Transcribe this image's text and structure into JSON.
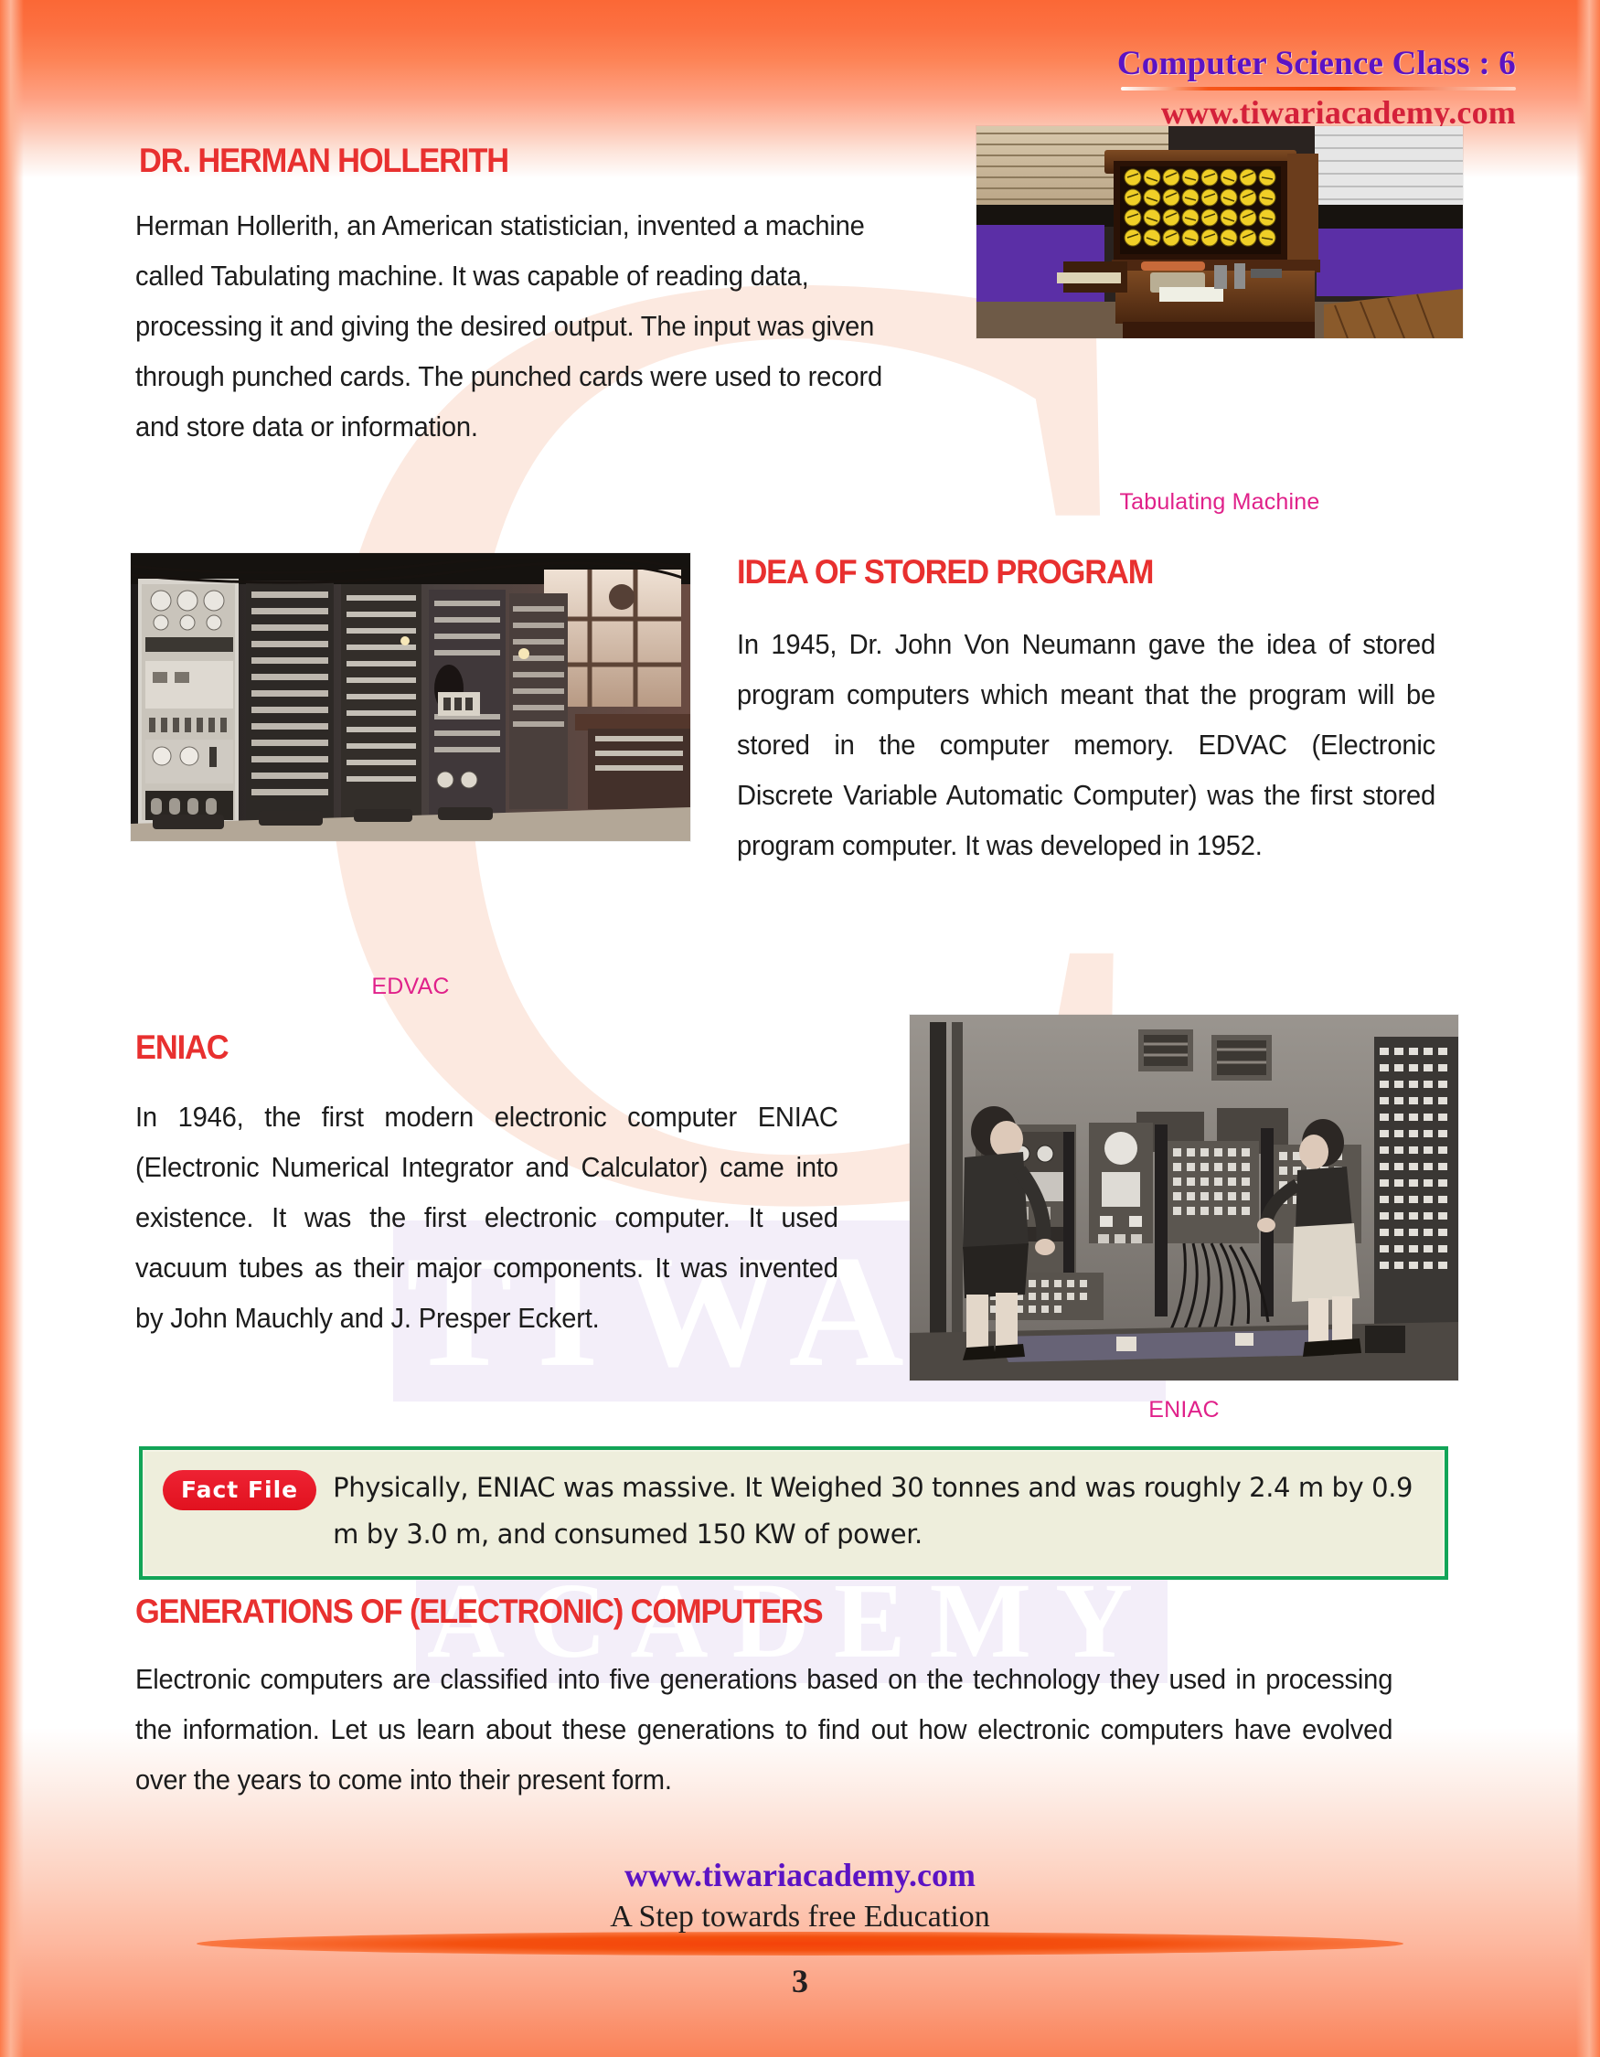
{
  "header": {
    "title": "Computer Science Class : 6",
    "website": "www.tiwariacademy.com"
  },
  "watermark": {
    "letter": "C",
    "word_top": "TIWARI",
    "word_bottom": "ACADEMY"
  },
  "sections": {
    "hollerith": {
      "heading": "DR. HERMAN HOLLERITH",
      "body": "Herman Hollerith, an American statistician, invented a machine called Tabulating machine. It was capable of reading data, processing it and giving the desired output. The input was given through punched cards. The punched cards were used to record and store data or information."
    },
    "stored_program": {
      "heading": "IDEA OF STORED PROGRAM",
      "body": "In 1945, Dr. John Von Neumann gave the idea of stored program computers which meant that the program will be stored in the computer memory. EDVAC (Electronic Discrete Variable Automatic Computer) was the first stored program computer. It was developed in 1952."
    },
    "eniac": {
      "heading": "ENIAC",
      "body": "In 1946, the first modern electronic computer ENIAC (Electronic Numerical Integrator and Calculator) came into existence. It was the first electronic computer. It used vacuum tubes as their major components. It was invented by John Mauchly and J. Presper Eckert."
    },
    "generations": {
      "heading": "GENERATIONS OF (ELECTRONIC) COMPUTERS",
      "body": "Electronic computers are classified into five generations based on the technology they used in processing the information. Let us learn about these generations to find out how electronic computers have evolved over the years to come into their present form."
    }
  },
  "figures": {
    "tabulating_machine": {
      "caption": "Tabulating Machine"
    },
    "edvac": {
      "caption": "EDVAC"
    },
    "eniac": {
      "caption": "ENIAC"
    }
  },
  "fact_file": {
    "badge": "Fact File",
    "text": "Physically, ENIAC was massive. It Weighed 30 tonnes and was roughly 2.4 m by 0.9 m by 3.0 m, and consumed 150 KW of power."
  },
  "footer": {
    "website": "www.tiwariacademy.com",
    "tagline": "A Step towards free Education",
    "page_number": "3"
  },
  "colors": {
    "heading_red": "#e8302f",
    "caption_pink": "#e0218a",
    "header_purple": "#5b13c4",
    "header_red": "#d4213a",
    "factfile_border": "#12a457",
    "factfile_bg": "#eeeedc",
    "badge_red": "#e1121f",
    "page_accent_orange": "#fb6836"
  }
}
